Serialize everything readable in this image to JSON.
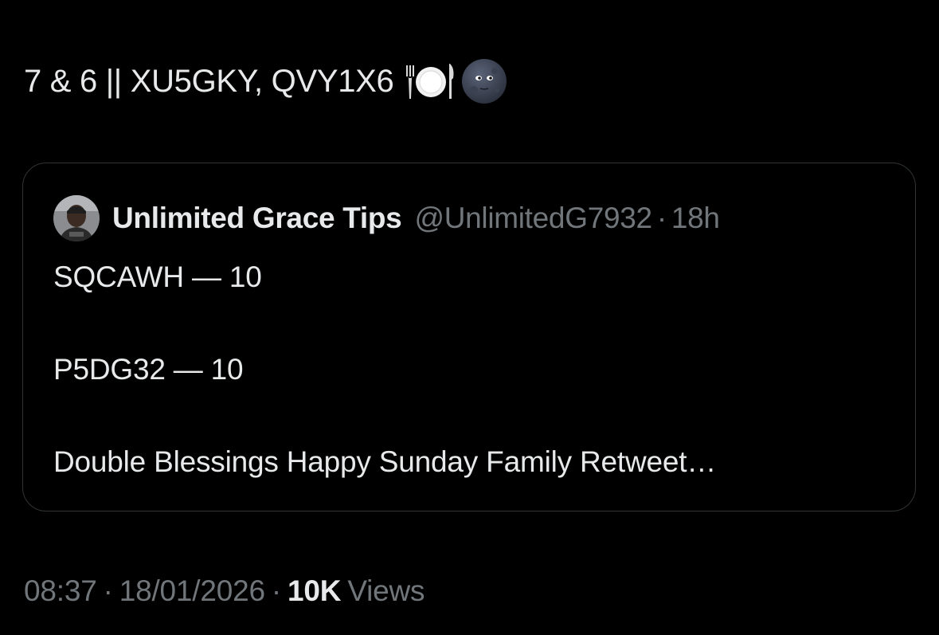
{
  "tweet": {
    "text": "7 & 6 || XU5GKY, QVY1X6",
    "emojis": [
      "plate-with-cutlery-icon",
      "new-moon-face-icon"
    ]
  },
  "quote": {
    "author_name": "Unlimited Grace Tips",
    "author_handle": "@UnlimitedG7932",
    "separator": "·",
    "time_ago": "18h",
    "lines": [
      "SQCAWH — 10",
      "P5DG32 — 10",
      "Double Blessings Happy Sunday Family Retweet…"
    ]
  },
  "footer": {
    "time": "08:37",
    "separator": "·",
    "date": "18/01/2026",
    "views_count": "10K",
    "views_label": "Views"
  },
  "colors": {
    "background": "#000000",
    "primary_text": "#e7e9ea",
    "secondary_text": "#71767b",
    "border": "#2f3336"
  }
}
